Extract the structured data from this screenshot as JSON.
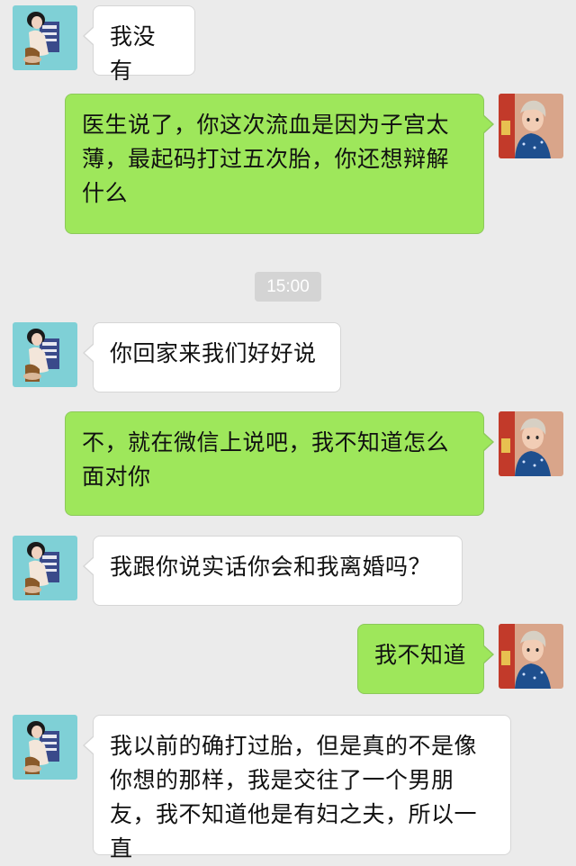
{
  "chat": {
    "timestamp": "15:00",
    "messages": [
      {
        "sender": "wife",
        "side": "left",
        "text": "我没有"
      },
      {
        "sender": "husband",
        "side": "right",
        "text": "医生说了，你这次流血是因为子宫太薄，最起码打过五次胎，你还想辩解什么"
      },
      {
        "sender": "wife",
        "side": "left",
        "text": "你回家来我们好好说"
      },
      {
        "sender": "husband",
        "side": "right",
        "text": "不，就在微信上说吧，我不知道怎么面对你"
      },
      {
        "sender": "wife",
        "side": "left",
        "text": "我跟你说实话你会和我离婚吗？"
      },
      {
        "sender": "husband",
        "side": "right",
        "text": "我不知道"
      },
      {
        "sender": "wife",
        "side": "left",
        "text": "我以前的确打过胎，但是真的不是像你想的那样，我是交往了一个男朋友，我不知道他是有妇之夫，所以一直"
      }
    ]
  },
  "colors": {
    "background": "#ebebeb",
    "incoming_bubble": "#ffffff",
    "outgoing_bubble": "#9ee75b",
    "timestamp_badge": "#d4d4d4"
  },
  "icons": {
    "wife_avatar": "woman-portrait-avatar",
    "husband_avatar": "man-portrait-avatar"
  }
}
